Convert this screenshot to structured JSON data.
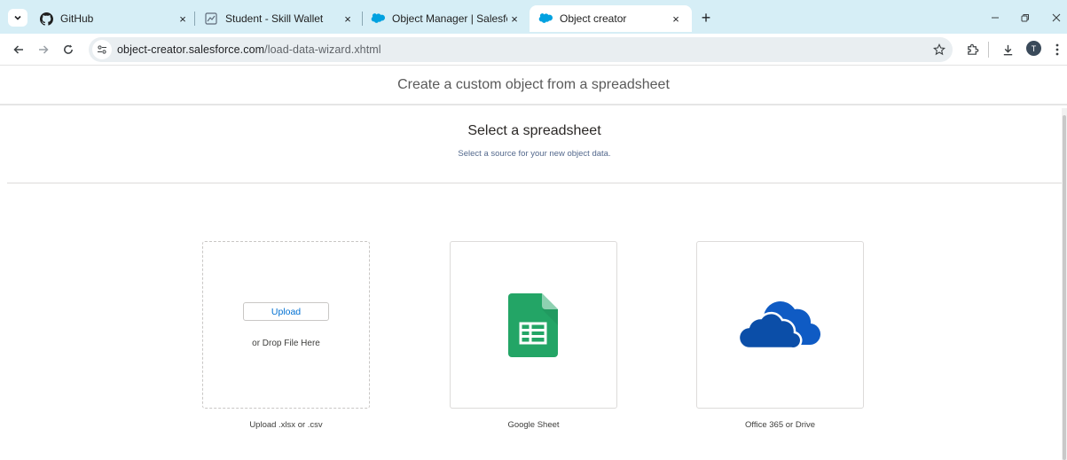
{
  "browser": {
    "tabs": [
      {
        "title": "GitHub",
        "icon": "github-icon"
      },
      {
        "title": "Student - Skill Wallet",
        "icon": "skill-wallet-icon"
      },
      {
        "title": "Object Manager | Salesforce",
        "icon": "salesforce-cloud-icon"
      },
      {
        "title": "Object creator",
        "icon": "salesforce-cloud-icon",
        "active": true
      }
    ],
    "new_tab_label": "+",
    "close_tab_label": "×",
    "url": {
      "host": "object-creator.salesforce.com",
      "path": "/load-data-wizard.xhtml"
    },
    "profile_initial": "T"
  },
  "page": {
    "title": "Create a custom object from a spreadsheet",
    "step_title": "Select a spreadsheet",
    "step_subtitle": "Select a source for your new object data.",
    "sources": [
      {
        "key": "upload",
        "button_label": "Upload",
        "drop_text": "or Drop File Here",
        "caption": "Upload .xlsx or .csv"
      },
      {
        "key": "google",
        "caption": "Google Sheet",
        "icon": "google-sheets-icon"
      },
      {
        "key": "office",
        "caption": "Office 365 or Drive",
        "icon": "onedrive-cloud-icon"
      }
    ]
  },
  "colors": {
    "tabstrip_bg": "#d6eef6",
    "omnibox_bg": "#e9eef1",
    "salesforce_blue": "#00a1e0",
    "link_blue": "#0070d2",
    "sheets_green": "#23a566",
    "onedrive_blue": "#0f5bc4"
  }
}
